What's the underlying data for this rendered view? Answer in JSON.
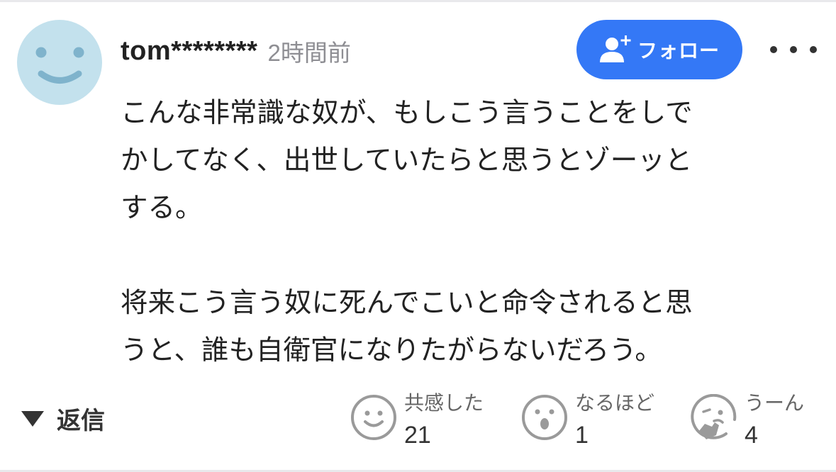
{
  "comment": {
    "username": "tom********",
    "timestamp": "2時間前",
    "paragraphs": [
      "こんな非常識な奴が、もしこう言うことをしで\nかしてなく、出世していたらと思うとゾーッと\nする。",
      "将来こう言う奴に死んでこいと命令されると思\nうと、誰も自衛官になりたがらないだろう。"
    ]
  },
  "follow": {
    "label": "フォロー",
    "icon": "person-add-icon"
  },
  "more": {
    "icon": "more-horizontal-icon"
  },
  "reply": {
    "label": "返信",
    "icon": "triangle-down-icon"
  },
  "reactions": [
    {
      "label": "共感した",
      "count": "21",
      "icon": "smile-face-icon"
    },
    {
      "label": "なるほど",
      "count": "1",
      "icon": "surprised-face-icon"
    },
    {
      "label": "うーん",
      "count": "4",
      "icon": "thinking-face-icon"
    }
  ],
  "colors": {
    "accent": "#3478f6",
    "avatar_bg": "#c3e1ed",
    "avatar_features": "#7fb3cc",
    "icon_gray": "#9a9a9a"
  }
}
